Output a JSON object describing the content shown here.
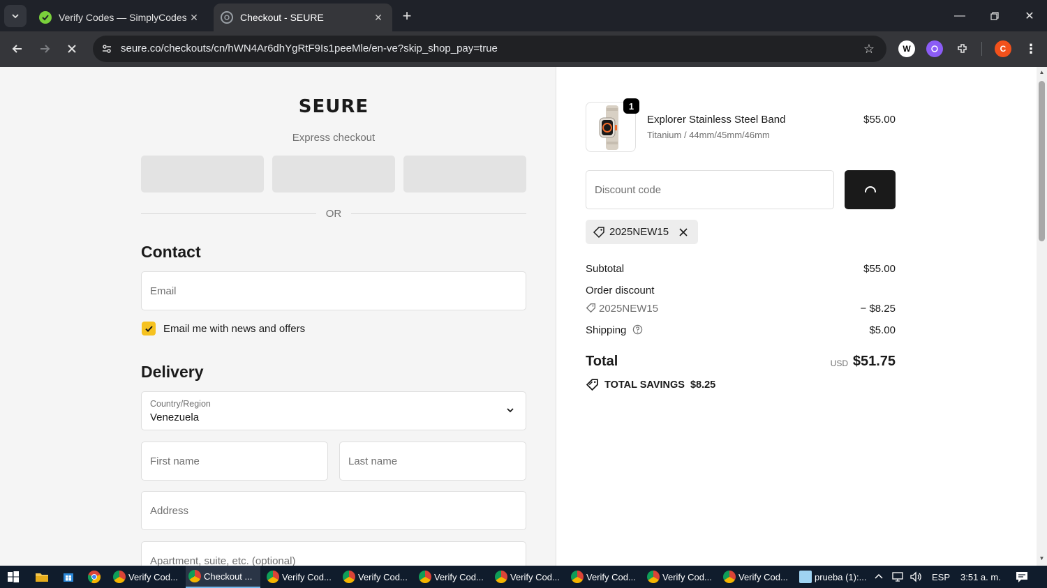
{
  "browser": {
    "tabs": [
      {
        "title": "Verify Codes — SimplyCodes",
        "active": false
      },
      {
        "title": "Checkout - SEURE",
        "active": true
      }
    ],
    "url": "seure.co/checkouts/cn/hWN4Ar6dhYgRtF9Is1peeMle/en-ve?skip_shop_pay=true",
    "profile_initial": "C",
    "colors": {
      "tabbar": "#1f2229",
      "toolbar": "#35363a",
      "profile": "#f2511b"
    }
  },
  "checkout": {
    "brand": "SEURE",
    "express_label": "Express checkout",
    "or_label": "OR",
    "contact_title": "Contact",
    "email_placeholder": "Email",
    "news_label": "Email me with news and offers",
    "news_checked": true,
    "delivery_title": "Delivery",
    "country_label": "Country/Region",
    "country_value": "Venezuela",
    "first_name_placeholder": "First name",
    "last_name_placeholder": "Last name",
    "address_placeholder": "Address",
    "apartment_placeholder": "Apartment, suite, etc. (optional)",
    "accent_color": "#f6c21f"
  },
  "summary": {
    "item": {
      "name": "Explorer Stainless Steel Band",
      "variant": "Titanium / 44mm/45mm/46mm",
      "price": "$55.00",
      "quantity": "1"
    },
    "discount_placeholder": "Discount code",
    "applied_code": "2025NEW15",
    "subtotal_label": "Subtotal",
    "subtotal_value": "$55.00",
    "order_discount_label": "Order discount",
    "discount_code": "2025NEW15",
    "discount_value": "− $8.25",
    "shipping_label": "Shipping",
    "shipping_value": "$5.00",
    "total_label": "Total",
    "total_currency": "USD",
    "total_value": "$51.75",
    "savings_label": "TOTAL SAVINGS",
    "savings_value": "$8.25"
  },
  "taskbar": {
    "tasks": [
      {
        "label": "Verify Cod...",
        "active": false
      },
      {
        "label": "Checkout ...",
        "active": true
      },
      {
        "label": "Verify Cod...",
        "active": false
      },
      {
        "label": "Verify Cod...",
        "active": false
      },
      {
        "label": "Verify Cod...",
        "active": false
      },
      {
        "label": "Verify Cod...",
        "active": false
      },
      {
        "label": "Verify Cod...",
        "active": false
      },
      {
        "label": "Verify Cod...",
        "active": false
      },
      {
        "label": "Verify Cod...",
        "active": false
      },
      {
        "label": "prueba (1):...",
        "active": false
      }
    ],
    "language": "ESP",
    "time": "3:51 a. m."
  }
}
